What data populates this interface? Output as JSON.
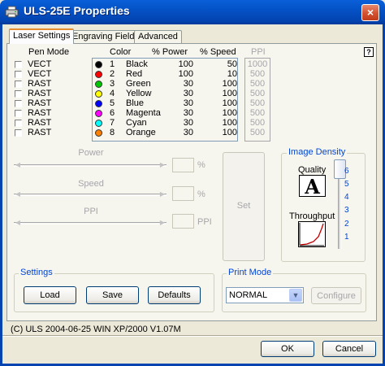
{
  "window": {
    "title": "ULS-25E Properties",
    "close_label": "×"
  },
  "tabs": [
    {
      "label": "Laser Settings",
      "active": true
    },
    {
      "label": "Engraving Field",
      "active": false
    },
    {
      "label": "Advanced",
      "active": false
    }
  ],
  "help_label": "?",
  "pen_table": {
    "headers": {
      "pen_mode": "Pen Mode",
      "color": "Color",
      "power": "% Power",
      "speed": "% Speed",
      "ppi": "PPI"
    },
    "rows": [
      {
        "mode": "VECT",
        "num": "1",
        "color": "Black",
        "power": "100",
        "speed": "50",
        "ppi": "1000",
        "swatch": "#000000"
      },
      {
        "mode": "VECT",
        "num": "2",
        "color": "Red",
        "power": "100",
        "speed": "10",
        "ppi": "500",
        "swatch": "#ff0000"
      },
      {
        "mode": "RAST",
        "num": "3",
        "color": "Green",
        "power": "30",
        "speed": "100",
        "ppi": "500",
        "swatch": "#00c800"
      },
      {
        "mode": "RAST",
        "num": "4",
        "color": "Yellow",
        "power": "30",
        "speed": "100",
        "ppi": "500",
        "swatch": "#ffff00"
      },
      {
        "mode": "RAST",
        "num": "5",
        "color": "Blue",
        "power": "30",
        "speed": "100",
        "ppi": "500",
        "swatch": "#0000ff"
      },
      {
        "mode": "RAST",
        "num": "6",
        "color": "Magenta",
        "power": "30",
        "speed": "100",
        "ppi": "500",
        "swatch": "#ff00ff"
      },
      {
        "mode": "RAST",
        "num": "7",
        "color": "Cyan",
        "power": "30",
        "speed": "100",
        "ppi": "500",
        "swatch": "#00ffff"
      },
      {
        "mode": "RAST",
        "num": "8",
        "color": "Orange",
        "power": "30",
        "speed": "100",
        "ppi": "500",
        "swatch": "#ff8000"
      }
    ]
  },
  "sliders": {
    "power_label": "Power",
    "power_unit": "%",
    "speed_label": "Speed",
    "speed_unit": "%",
    "ppi_label": "PPI",
    "ppi_unit": "PPI"
  },
  "set_label": "Set",
  "image_density": {
    "group_label": "Image Density",
    "quality_label": "Quality",
    "quality_letter": "A",
    "throughput_label": "Throughput",
    "ticks": [
      "6",
      "5",
      "4",
      "3",
      "2",
      "1"
    ],
    "selected": "6"
  },
  "settings": {
    "group_label": "Settings",
    "load_label": "Load",
    "save_label": "Save",
    "defaults_label": "Defaults"
  },
  "print_mode": {
    "group_label": "Print Mode",
    "value": "NORMAL",
    "configure_label": "Configure"
  },
  "status_text": "(C) ULS 2004-06-25 WIN XP/2000 V1.07M",
  "footer": {
    "ok_label": "OK",
    "cancel_label": "Cancel"
  },
  "colors": {
    "titlebar": "#0452c6",
    "group_label": "#0046d5",
    "tab_highlight": "#e68b2c"
  }
}
